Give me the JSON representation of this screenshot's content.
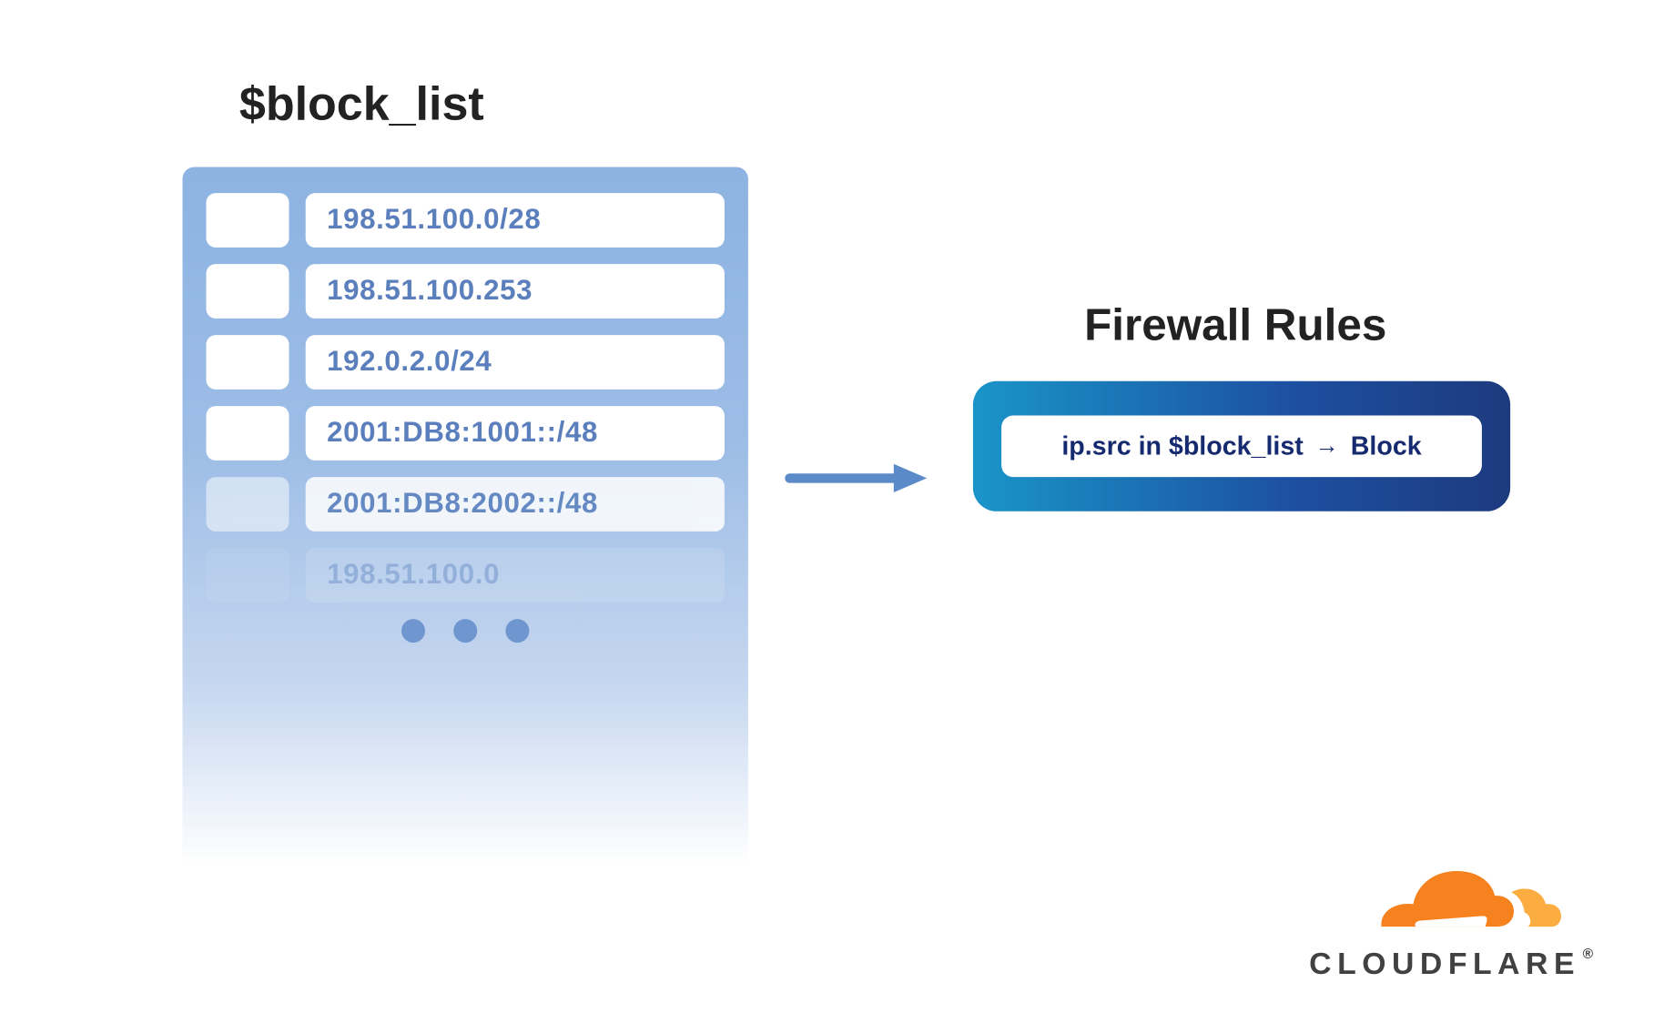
{
  "block_list": {
    "title": "$block_list",
    "items": [
      "198.51.100.0/28",
      "198.51.100.253",
      "192.0.2.0/24",
      "2001:DB8:1001::/48",
      "2001:DB8:2002::/48",
      "198.51.100.0"
    ]
  },
  "firewall": {
    "title": "Firewall Rules",
    "rule_lhs": "ip.src in $block_list",
    "rule_action": "Block"
  },
  "branding": {
    "name": "CLOUDFLARE"
  }
}
